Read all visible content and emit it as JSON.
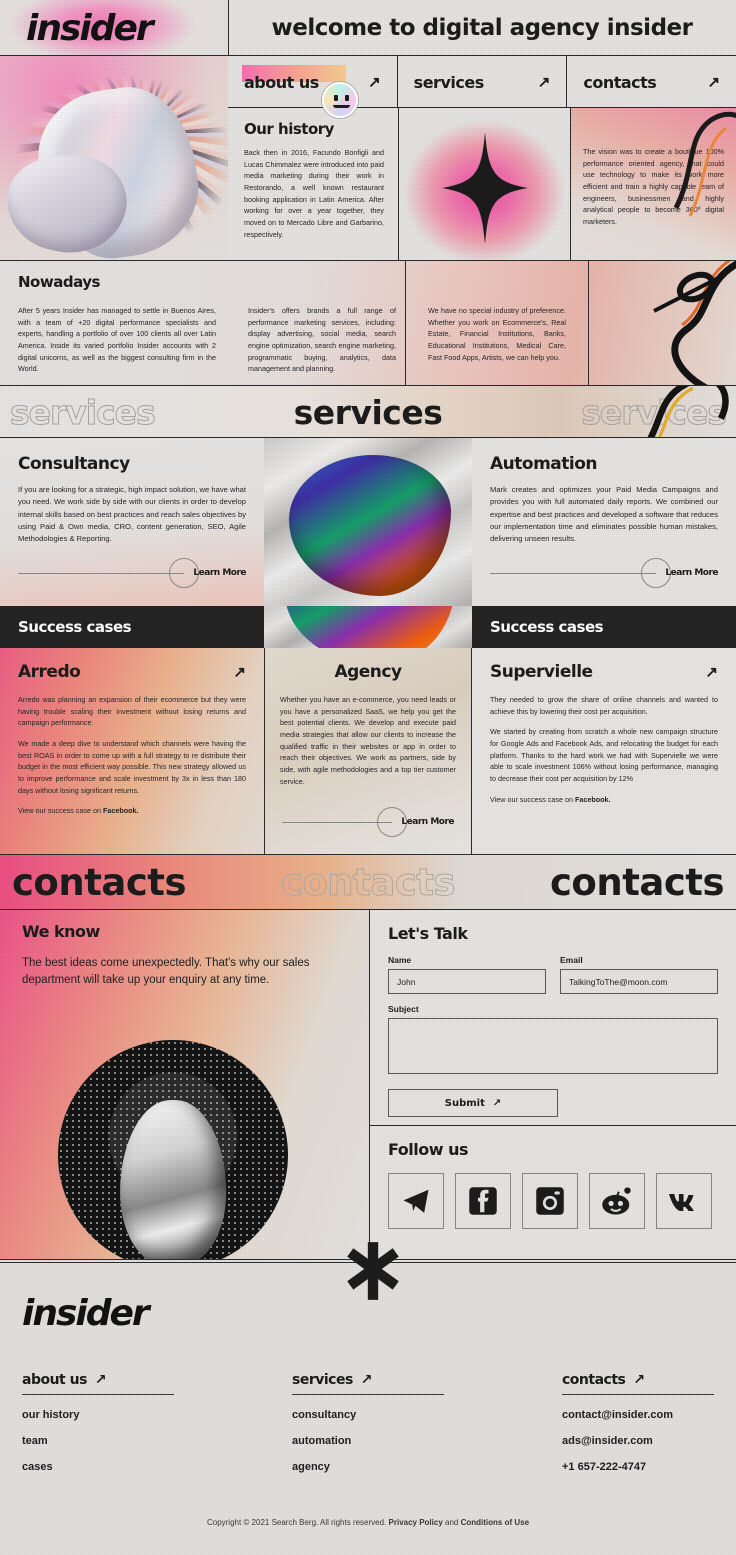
{
  "header": {
    "logo": "insider",
    "title": "welcome to digital agency insider"
  },
  "nav": {
    "items": [
      {
        "label": "about us",
        "icon": "arrow-up-right-icon",
        "highlighted": true
      },
      {
        "label": "services",
        "icon": "arrow-up-right-icon",
        "highlighted": false
      },
      {
        "label": "contacts",
        "icon": "arrow-up-right-icon",
        "highlighted": false
      }
    ]
  },
  "history": {
    "heading": "Our history",
    "text": "Back then in 2016, Facundo Bonfigli and Lucas Chimmalez were introduced into paid media marketing during their work in Restorando, a well known restaurant booking application in Latin America. After working for over a year together, they moved on to Mercado Libre and Garbarino, respectively.",
    "vision": "The vision was to create a boutique 100% performance oriented agency, that could use technology to make its work more efficient and train a highly capable team of engineers, businessmen and highly analytical people to become 360º digital marketers."
  },
  "nowadays": {
    "heading": "Nowadays",
    "col1": "After 5 years Insider has managed to settle in Buenos Aires, with a team of +20 digital performance specialists and experts, handling a portfolio of over 100 clients all over Latin America. Inside its varied portfolio Insider accounts with 2 digital unicorns, as well as the biggest consulting firm in the World.",
    "col2": "Insider's offers brands a full range of performance marketing services, including: display advertising, social media, search engine optimization, search engine marketing, programmatic buying, analytics, data management and planning.",
    "col3": "We have no special industry of preference. Whether you work on Ecommerce's, Real Estate, Financial Institutions, Banks, Educational Institutions, Medical Care, Fast Food Apps, Artists, we can help you."
  },
  "services_banner": {
    "ghost_left": "services",
    "solid": "services",
    "ghost_right": "services"
  },
  "services": [
    {
      "title": "Consultancy",
      "text": "If you are looking for a strategic, high impact solution, we have what you need. We work side by side with our clients in order to develop internal skills based on best practices and reach sales objectives by using Paid & Own media, CRO, content generation, SEO, Agile Methodologies & Reporting.",
      "cta": "Learn More"
    },
    {
      "title": "Automation",
      "text": "Mark creates and optimizes your Paid Media Campaigns and provides you with full automated daily reports. We combined our expertise and best practices and developed a software that reduces our implementation time and eliminates possible human mistakes, delivering unseen results.",
      "cta": "Learn More"
    }
  ],
  "success_banner": {
    "left": "Success cases",
    "right": "Success cases"
  },
  "cases": [
    {
      "title": "Arredo",
      "icon": "arrow-up-right-icon",
      "p1": "Arredo was planning an expansion of their ecommerce but they were having trouble scaling their investment without losing returns and campaign performance.",
      "p2": "We made a deep dive to understand which channels were having the best ROAS in order to come up with a full strategy to re distribute their budget in the most efficient way possible. This new strategy allowed us to improve performance and scale investment by 3x in less than 180 days without losing significant returns.",
      "link_prefix": "View our success case on ",
      "link_label": "Facebook."
    },
    {
      "title": "Agency",
      "p1": "Whether you have an e-commerce, you need leads or you have a personalized SaaS, we help you get the best potential clients. We develop and execute paid media strategies that allow our clients to increase the qualified traffic in their websites or app in order to reach their objectives. We work as partners, side by side, with agile methodologies and a top tier customer service.",
      "cta": "Learn More"
    },
    {
      "title": "Supervielle",
      "icon": "arrow-up-right-icon",
      "p1": "They needed to grow the share of online channels and wanted to achieve this by lowering their cost per acquisition.",
      "p2": "We started by creating from scratch a whole new campaign structure for Google Ads and Facebook Ads, and relocating the budget for each platform. Thanks to the hard work we had with Supervielle we were able to scale investment 106% without losing performance, managing to decrease their cost per acquisition by 12%",
      "link_prefix": "View our success case on ",
      "link_label": "Facebook."
    }
  ],
  "contacts_banner": {
    "solid_left": "contacts",
    "ghost_mid": "contacts",
    "solid_right": "contacts"
  },
  "we_know": {
    "heading": "We know",
    "text": "The best ideas come unexpectedly. That's why our sales department will take up your enquiry at any time."
  },
  "form": {
    "heading": "Let's Talk",
    "name_label": "Name",
    "name_value": "John",
    "email_label": "Email",
    "email_value": "TalkingToThe@moon.com",
    "subject_label": "Subject",
    "subject_value": "",
    "submit_label": "Submit",
    "submit_icon": "arrow-up-right-icon"
  },
  "follow": {
    "heading": "Follow us",
    "socials": [
      {
        "name": "telegram-icon"
      },
      {
        "name": "facebook-icon"
      },
      {
        "name": "instagram-icon"
      },
      {
        "name": "reddit-icon"
      },
      {
        "name": "vk-icon"
      }
    ]
  },
  "footer": {
    "logo": "insider",
    "columns": [
      {
        "title": "about us",
        "icon": "arrow-up-right-icon",
        "links": [
          "our history",
          "team",
          "cases"
        ]
      },
      {
        "title": "services",
        "icon": "arrow-up-right-icon",
        "links": [
          "consultancy",
          "automation",
          "agency"
        ]
      },
      {
        "title": "contacts",
        "icon": "arrow-up-right-icon",
        "links": [
          "contact@insider.com",
          "ads@insider.com",
          "+1 657-222-4747"
        ]
      }
    ],
    "copyright_pre": "Copyright © 2021 Search Berg. All rights reserved. ",
    "privacy": "Privacy Policy",
    "copyright_mid": " and ",
    "terms": "Conditions of Use"
  },
  "colors": {
    "pink": "#ef4f8e",
    "dark": "#242424",
    "paper": "#e3e3e1"
  }
}
